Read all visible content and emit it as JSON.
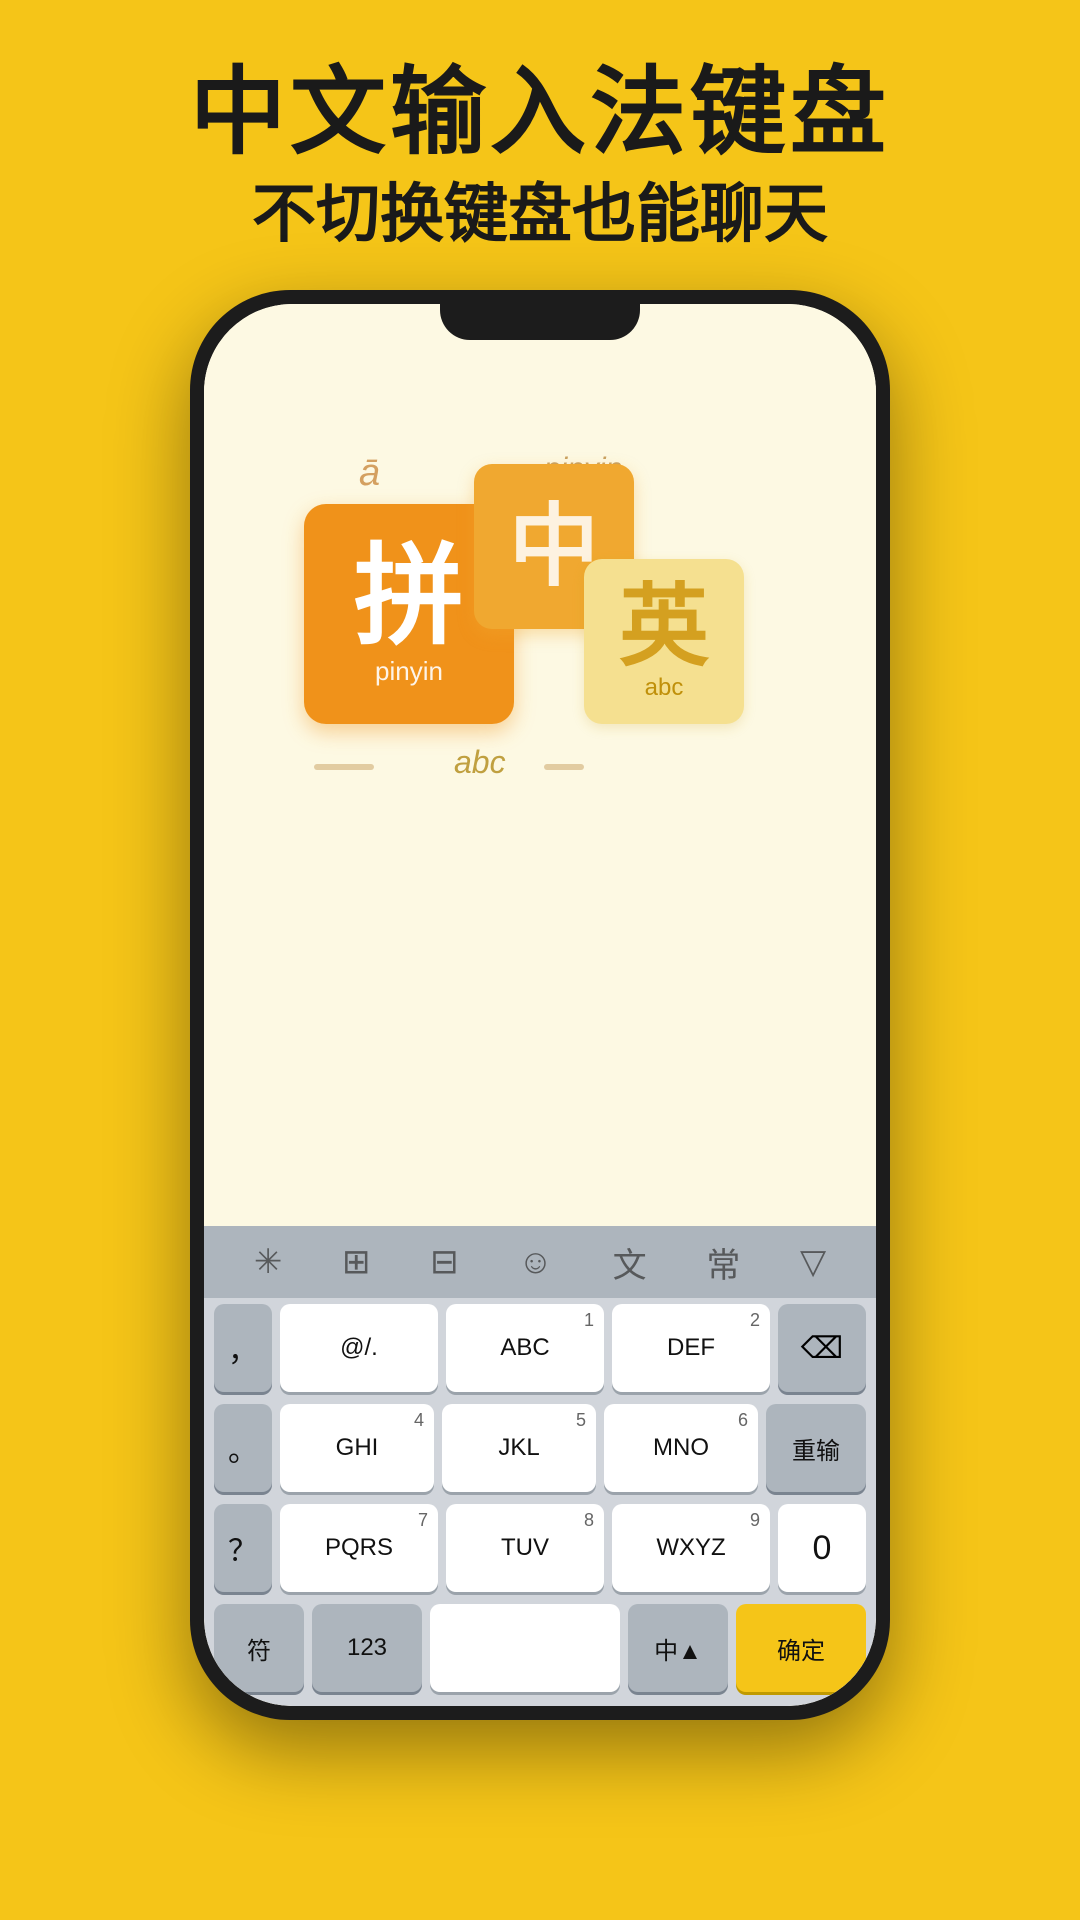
{
  "header": {
    "title_main": "中文输入法键盘",
    "title_sub": "不切换键盘也能聊天"
  },
  "phone": {
    "keys_display": {
      "pinyin_char": "拼",
      "pinyin_label": "pinyin",
      "zhong_char": "中",
      "ying_char": "英",
      "ying_label": "abc",
      "float_pinyin": "pinyin",
      "float_a_bar": "ā",
      "float_abc": "abc"
    },
    "toolbar": {
      "icons": [
        "⌘",
        "⊞",
        "⊟",
        "☺",
        "文",
        "常",
        "▽"
      ]
    },
    "keyboard": {
      "row1": [
        {
          "label": "，",
          "num": ""
        },
        {
          "label": "@/.",
          "num": ""
        },
        {
          "label": "ABC",
          "num": "1"
        },
        {
          "label": "DEF",
          "num": "2"
        },
        {
          "label": "⌫",
          "num": ""
        }
      ],
      "row2": [
        {
          "label": "。",
          "num": ""
        },
        {
          "label": "GHI",
          "num": "4"
        },
        {
          "label": "JKL",
          "num": "5"
        },
        {
          "label": "MNO",
          "num": "6"
        },
        {
          "label": "重输",
          "num": "",
          "type": "gray"
        }
      ],
      "row3": [
        {
          "label": "？",
          "num": ""
        },
        {
          "label": "PQRS",
          "num": "7"
        },
        {
          "label": "TUV",
          "num": "8"
        },
        {
          "label": "WXYZ",
          "num": "9"
        },
        {
          "label": "0",
          "num": ""
        }
      ],
      "row_bottom": [
        {
          "label": "符",
          "type": "gray"
        },
        {
          "label": "123",
          "type": "gray"
        },
        {
          "label": "　",
          "type": "white"
        },
        {
          "label": "中▲",
          "type": "gray"
        },
        {
          "label": "确定",
          "type": "yellow"
        }
      ]
    }
  }
}
